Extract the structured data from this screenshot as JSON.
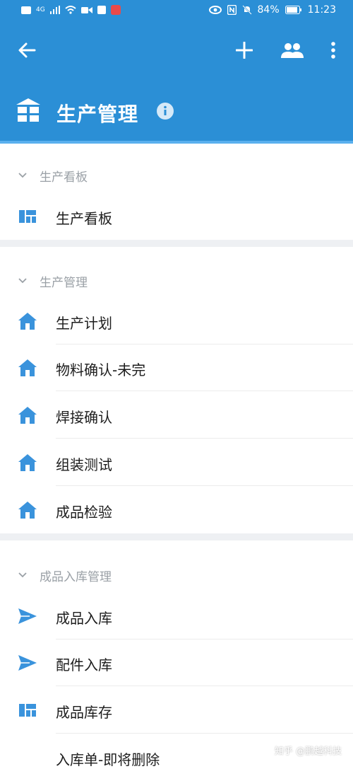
{
  "status": {
    "signal": "4G",
    "battery": "84%",
    "time": "11:23"
  },
  "header": {
    "title": "生产管理"
  },
  "sections": [
    {
      "label": "生产看板"
    },
    {
      "label": "生产管理"
    },
    {
      "label": "成品入库管理"
    }
  ],
  "items": [
    {
      "label": "生产看板"
    },
    {
      "label": "生产计划"
    },
    {
      "label": "物料确认-未完"
    },
    {
      "label": "焊接确认"
    },
    {
      "label": "组装测试"
    },
    {
      "label": "成品检验"
    },
    {
      "label": "成品入库"
    },
    {
      "label": "配件入库"
    },
    {
      "label": "成品库存"
    },
    {
      "label": "入库单-即将删除"
    }
  ],
  "watermark": "知乎 @鹏越科技",
  "colors": {
    "primary": "#2b8fd6",
    "icon": "#3a93dc"
  }
}
